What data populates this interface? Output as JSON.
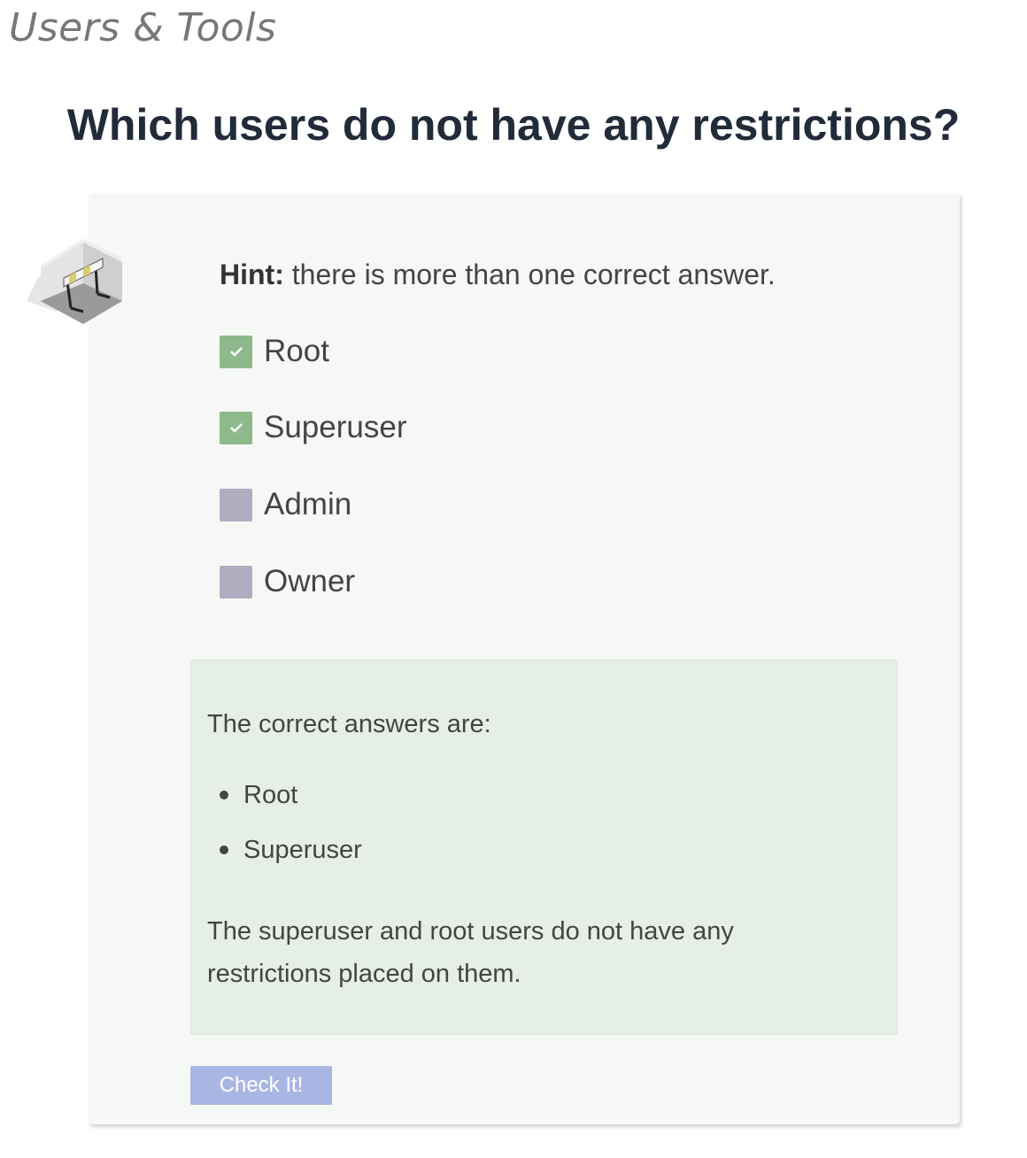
{
  "section_title": "Users & Tools",
  "question": "Which users do not have any restrictions?",
  "badge": {
    "icon": "hurdle-room-icon"
  },
  "hint": {
    "label": "Hint:",
    "text": "there is more than one correct answer."
  },
  "options": [
    {
      "label": "Root",
      "checked": true
    },
    {
      "label": "Superuser",
      "checked": true
    },
    {
      "label": "Admin",
      "checked": false
    },
    {
      "label": "Owner",
      "checked": false
    }
  ],
  "feedback": {
    "intro": "The correct answers are:",
    "answers": [
      "Root",
      "Superuser"
    ],
    "explanation": "The superuser and root users do not have any restrictions placed on them."
  },
  "check_button_label": "Check It!",
  "colors": {
    "checked": "#8db98c",
    "unchecked": "#aeaec0",
    "feedback_bg": "#e6efe5",
    "button": "#a9b6e4",
    "heading": "#222b3a"
  }
}
